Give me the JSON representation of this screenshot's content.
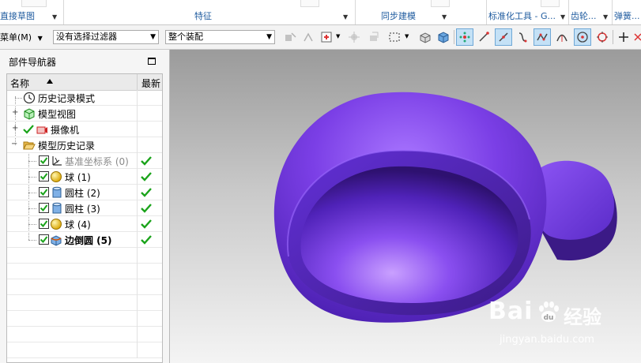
{
  "ribbon": {
    "groups": [
      {
        "label": "直接草图",
        "has_menu": true
      },
      {
        "label": "特征",
        "has_menu": true
      },
      {
        "label": "同步建模",
        "has_menu": true
      },
      {
        "label": "标准化工具 - G...",
        "has_menu": true
      },
      {
        "label": "齿轮...",
        "has_menu": true
      },
      {
        "label": "弹簧...",
        "has_menu": false
      }
    ]
  },
  "selection_bar": {
    "menu_label": "菜单(M)",
    "filter_value": "没有选择过滤器",
    "scope_value": "整个装配"
  },
  "navigator": {
    "title": "部件导航器",
    "col_name": "名称",
    "col_latest": "最新",
    "nodes": [
      {
        "label": "历史记录模式",
        "icon": "clock-icon"
      },
      {
        "label": "模型视图",
        "icon": "model-views-icon"
      },
      {
        "label": "摄像机",
        "icon": "camera-icon"
      },
      {
        "label": "模型历史记录",
        "icon": "open-folder-icon"
      },
      {
        "label": "基准坐标系 (0)",
        "icon": "datum-csys-icon",
        "latest": true
      },
      {
        "label": "球 (1)",
        "icon": "sphere-icon",
        "latest": true
      },
      {
        "label": "圆柱 (2)",
        "icon": "cylinder-icon",
        "latest": true
      },
      {
        "label": "圆柱 (3)",
        "icon": "cylinder-icon",
        "latest": true
      },
      {
        "label": "球 (4)",
        "icon": "sphere-icon",
        "latest": true
      },
      {
        "label": "边倒圆 (5)",
        "icon": "edge-blend-icon",
        "latest": true
      }
    ]
  },
  "watermark": {
    "brand": "Bai",
    "brand_cn": "经验",
    "url": "jingyan.baidu.com"
  },
  "colors": {
    "model": "#7b3fe6",
    "model_dark": "#3b1a86",
    "check_green": "#1aa31a",
    "ribbon_label": "#1f5b9f"
  }
}
